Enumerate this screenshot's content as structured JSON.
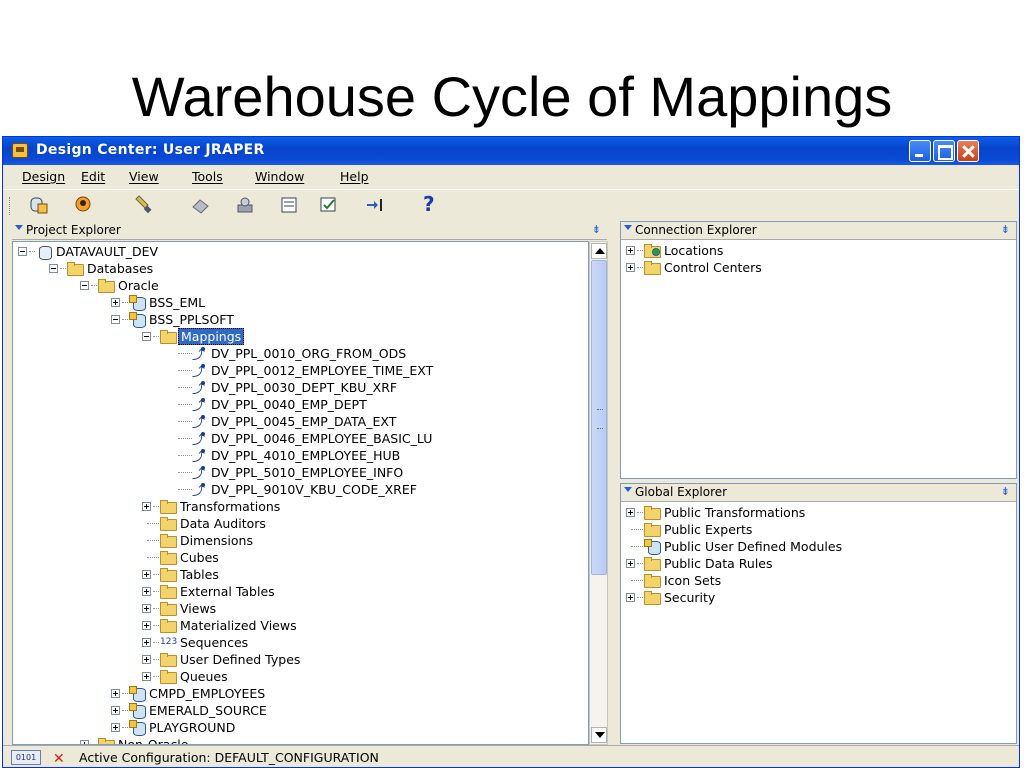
{
  "slide": {
    "title": "Warehouse Cycle of Mappings"
  },
  "window": {
    "title": "Design Center: User JRAPER"
  },
  "menu": [
    "Design",
    "Edit",
    "View",
    "Tools",
    "Window",
    "Help"
  ],
  "toolbar": {
    "help_glyph": "?"
  },
  "project_explorer": {
    "title": "Project Explorer",
    "tree": [
      {
        "label": "DATAVAULT_DEV",
        "level": 0,
        "expander": "minus",
        "icon": "db-icon"
      },
      {
        "label": "Databases",
        "level": 1,
        "expander": "minus",
        "icon": "folder-icon"
      },
      {
        "label": "Oracle",
        "level": 2,
        "expander": "minus",
        "icon": "folder-icon"
      },
      {
        "label": "BSS_EML",
        "level": 3,
        "expander": "plus",
        "icon": "module-icon"
      },
      {
        "label": "BSS_PPLSOFT",
        "level": 3,
        "expander": "minus",
        "icon": "module-icon"
      },
      {
        "label": "Mappings",
        "level": 4,
        "expander": "minus",
        "icon": "folder-icon",
        "selected": true
      },
      {
        "label": "DV_PPL_0010_ORG_FROM_ODS",
        "level": 5,
        "expander": "",
        "icon": "mapping-icon"
      },
      {
        "label": "DV_PPL_0012_EMPLOYEE_TIME_EXT",
        "level": 5,
        "expander": "",
        "icon": "mapping-icon"
      },
      {
        "label": "DV_PPL_0030_DEPT_KBU_XRF",
        "level": 5,
        "expander": "",
        "icon": "mapping-icon"
      },
      {
        "label": "DV_PPL_0040_EMP_DEPT",
        "level": 5,
        "expander": "",
        "icon": "mapping-icon"
      },
      {
        "label": "DV_PPL_0045_EMP_DATA_EXT",
        "level": 5,
        "expander": "",
        "icon": "mapping-icon"
      },
      {
        "label": "DV_PPL_0046_EMPLOYEE_BASIC_LU",
        "level": 5,
        "expander": "",
        "icon": "mapping-icon"
      },
      {
        "label": "DV_PPL_4010_EMPLOYEE_HUB",
        "level": 5,
        "expander": "",
        "icon": "mapping-icon"
      },
      {
        "label": "DV_PPL_5010_EMPLOYEE_INFO",
        "level": 5,
        "expander": "",
        "icon": "mapping-icon"
      },
      {
        "label": "DV_PPL_9010V_KBU_CODE_XREF",
        "level": 5,
        "expander": "",
        "icon": "mapping-icon"
      },
      {
        "label": "Transformations",
        "level": 4,
        "expander": "plus",
        "icon": "folder-icon"
      },
      {
        "label": "Data Auditors",
        "level": 4,
        "expander": "",
        "icon": "folder-icon"
      },
      {
        "label": "Dimensions",
        "level": 4,
        "expander": "",
        "icon": "folder-icon"
      },
      {
        "label": "Cubes",
        "level": 4,
        "expander": "",
        "icon": "folder-icon"
      },
      {
        "label": "Tables",
        "level": 4,
        "expander": "plus",
        "icon": "folder-icon"
      },
      {
        "label": "External Tables",
        "level": 4,
        "expander": "plus",
        "icon": "folder-icon"
      },
      {
        "label": "Views",
        "level": 4,
        "expander": "plus",
        "icon": "folder-icon"
      },
      {
        "label": "Materialized Views",
        "level": 4,
        "expander": "plus",
        "icon": "folder-icon"
      },
      {
        "label": "Sequences",
        "level": 4,
        "expander": "plus",
        "icon": "sequence-icon"
      },
      {
        "label": "User Defined Types",
        "level": 4,
        "expander": "plus",
        "icon": "folder-icon"
      },
      {
        "label": "Queues",
        "level": 4,
        "expander": "plus",
        "icon": "folder-icon"
      },
      {
        "label": "CMPD_EMPLOYEES",
        "level": 3,
        "expander": "plus",
        "icon": "module-icon"
      },
      {
        "label": "EMERALD_SOURCE",
        "level": 3,
        "expander": "plus",
        "icon": "module-icon"
      },
      {
        "label": "PLAYGROUND",
        "level": 3,
        "expander": "plus",
        "icon": "module-icon"
      },
      {
        "label": "Non-Oracle",
        "level": 2,
        "expander": "plus",
        "icon": "folder-icon"
      }
    ]
  },
  "connection_explorer": {
    "title": "Connection Explorer",
    "tree": [
      {
        "label": "Locations",
        "expander": "plus",
        "icon": "globe-folder-icon"
      },
      {
        "label": "Control Centers",
        "expander": "plus",
        "icon": "folder-icon"
      }
    ]
  },
  "global_explorer": {
    "title": "Global Explorer",
    "tree": [
      {
        "label": "Public Transformations",
        "expander": "plus",
        "icon": "folder-icon"
      },
      {
        "label": "Public Experts",
        "expander": "",
        "icon": "folder-icon"
      },
      {
        "label": "Public User Defined Modules",
        "expander": "",
        "icon": "module-icon"
      },
      {
        "label": "Public Data Rules",
        "expander": "plus",
        "icon": "folder-icon"
      },
      {
        "label": "Icon Sets",
        "expander": "",
        "icon": "folder-icon"
      },
      {
        "label": "Security",
        "expander": "plus",
        "icon": "folder-icon"
      }
    ]
  },
  "status": {
    "icon_text": "0101",
    "text": "Active Configuration: DEFAULT_CONFIGURATION"
  },
  "colors": {
    "titlebar": "#0a4ad6",
    "selection": "#316ac5",
    "chrome": "#ece9d8"
  }
}
